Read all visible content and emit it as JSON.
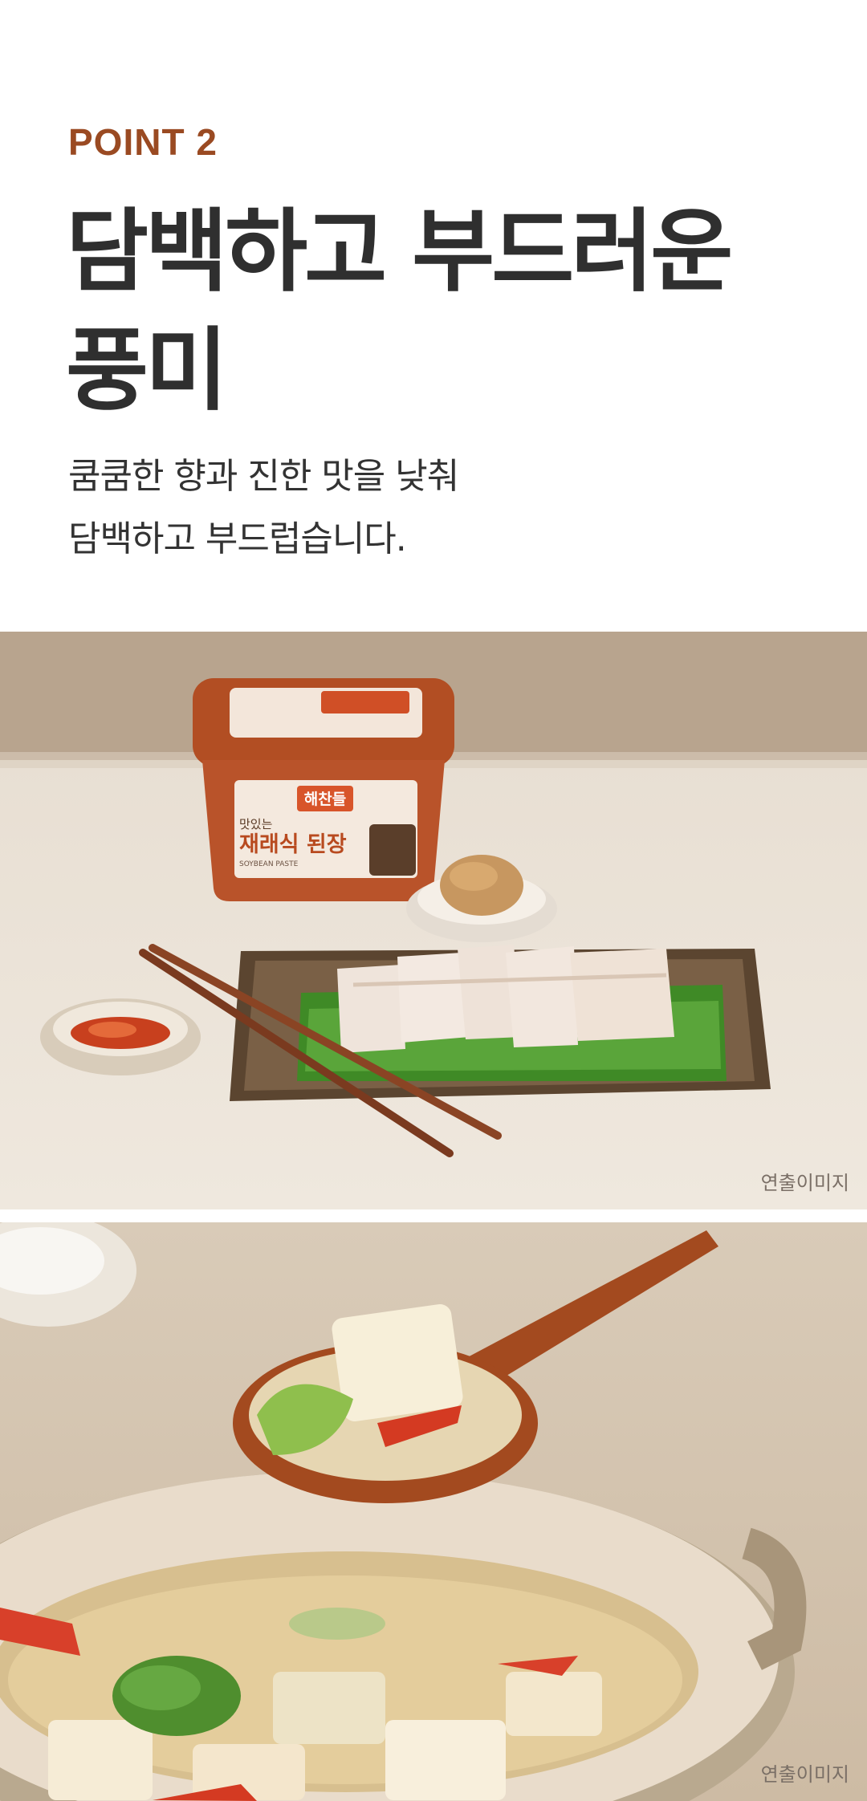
{
  "point": {
    "label": "POINT 2"
  },
  "headline": {
    "line1": "담백하고 부드러운",
    "line2": "풍미"
  },
  "description": {
    "line1": "쿰쿰한 향과 진한 맛을 낮춰",
    "line2": "담백하고 부드럽습니다."
  },
  "photo1": {
    "caption": "연출이미지",
    "package": {
      "brand": "해찬들",
      "subtitle": "맛있는",
      "name": "재래식 된장",
      "english": "SOYBEAN PASTE"
    }
  },
  "photo2": {
    "caption": "연출이미지"
  },
  "colors": {
    "accent": "#9a4a22",
    "headline": "#2f2f2f",
    "text": "#333333"
  }
}
